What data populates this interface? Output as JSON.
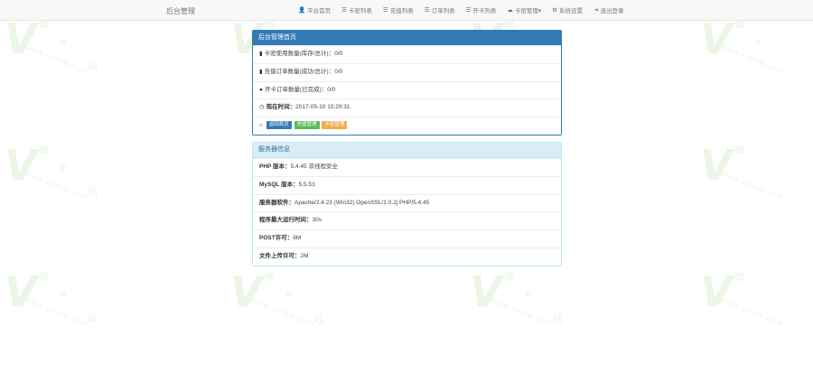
{
  "watermark": {
    "letter": "V",
    "chars": [
      "微",
      "e",
      "站"
    ],
    "url": "www.vioee.com"
  },
  "navbar": {
    "brand": "后台管理",
    "items": [
      {
        "icon": "user-icon",
        "glyph": "👤",
        "label": "平台首页"
      },
      {
        "icon": "list-icon",
        "glyph": "☰",
        "label": "卡密列表"
      },
      {
        "icon": "list-icon",
        "glyph": "☰",
        "label": "充值列表"
      },
      {
        "icon": "list-icon",
        "glyph": "☰",
        "label": "订单列表"
      },
      {
        "icon": "list-icon",
        "glyph": "☰",
        "label": "开卡列表"
      },
      {
        "icon": "cloud-icon",
        "glyph": "☁",
        "label": "卡密管理▾"
      },
      {
        "icon": "gear-icon",
        "glyph": "⚙",
        "label": "系统设置"
      },
      {
        "icon": "logout-icon",
        "glyph": "⇥",
        "label": "退出登录"
      }
    ]
  },
  "panel_home": {
    "title": "后台管理首页",
    "rows": [
      {
        "icon": "bar-chart-icon",
        "glyph": "▮",
        "label": "卡密使用数量(库存/总计)：",
        "value": "0/0"
      },
      {
        "icon": "bar-chart-icon",
        "glyph": "▮",
        "label": "充值订单数量(成功/总计)：",
        "value": "0/0"
      },
      {
        "icon": "drop-icon",
        "glyph": "●",
        "label": "开卡订单数量(已完成)：",
        "value": "0/0"
      },
      {
        "icon": "clock-icon",
        "glyph": "◷",
        "label": "现在时间：",
        "value": "2017-05-10 15:29:31"
      }
    ],
    "buttons": {
      "icon": "home-icon",
      "glyph": "⌂",
      "b1": "返回首页",
      "b2": "充值管理",
      "b3": "卡密管理"
    }
  },
  "panel_server": {
    "title": "服务器信息",
    "rows": [
      {
        "label": "PHP 版本：",
        "value": "5.4.45 非线程安全"
      },
      {
        "label": "MySQL 版本：",
        "value": "5.5.53"
      },
      {
        "label": "服务器软件：",
        "value": "Apache/2.4.23 (Win32) OpenSSL/1.0.2j PHP/5.4.45"
      },
      {
        "label": "程序最大运行时间：",
        "value": "30s"
      },
      {
        "label": "POST许可：",
        "value": "8M"
      },
      {
        "label": "文件上传许可：",
        "value": "2M"
      }
    ]
  }
}
